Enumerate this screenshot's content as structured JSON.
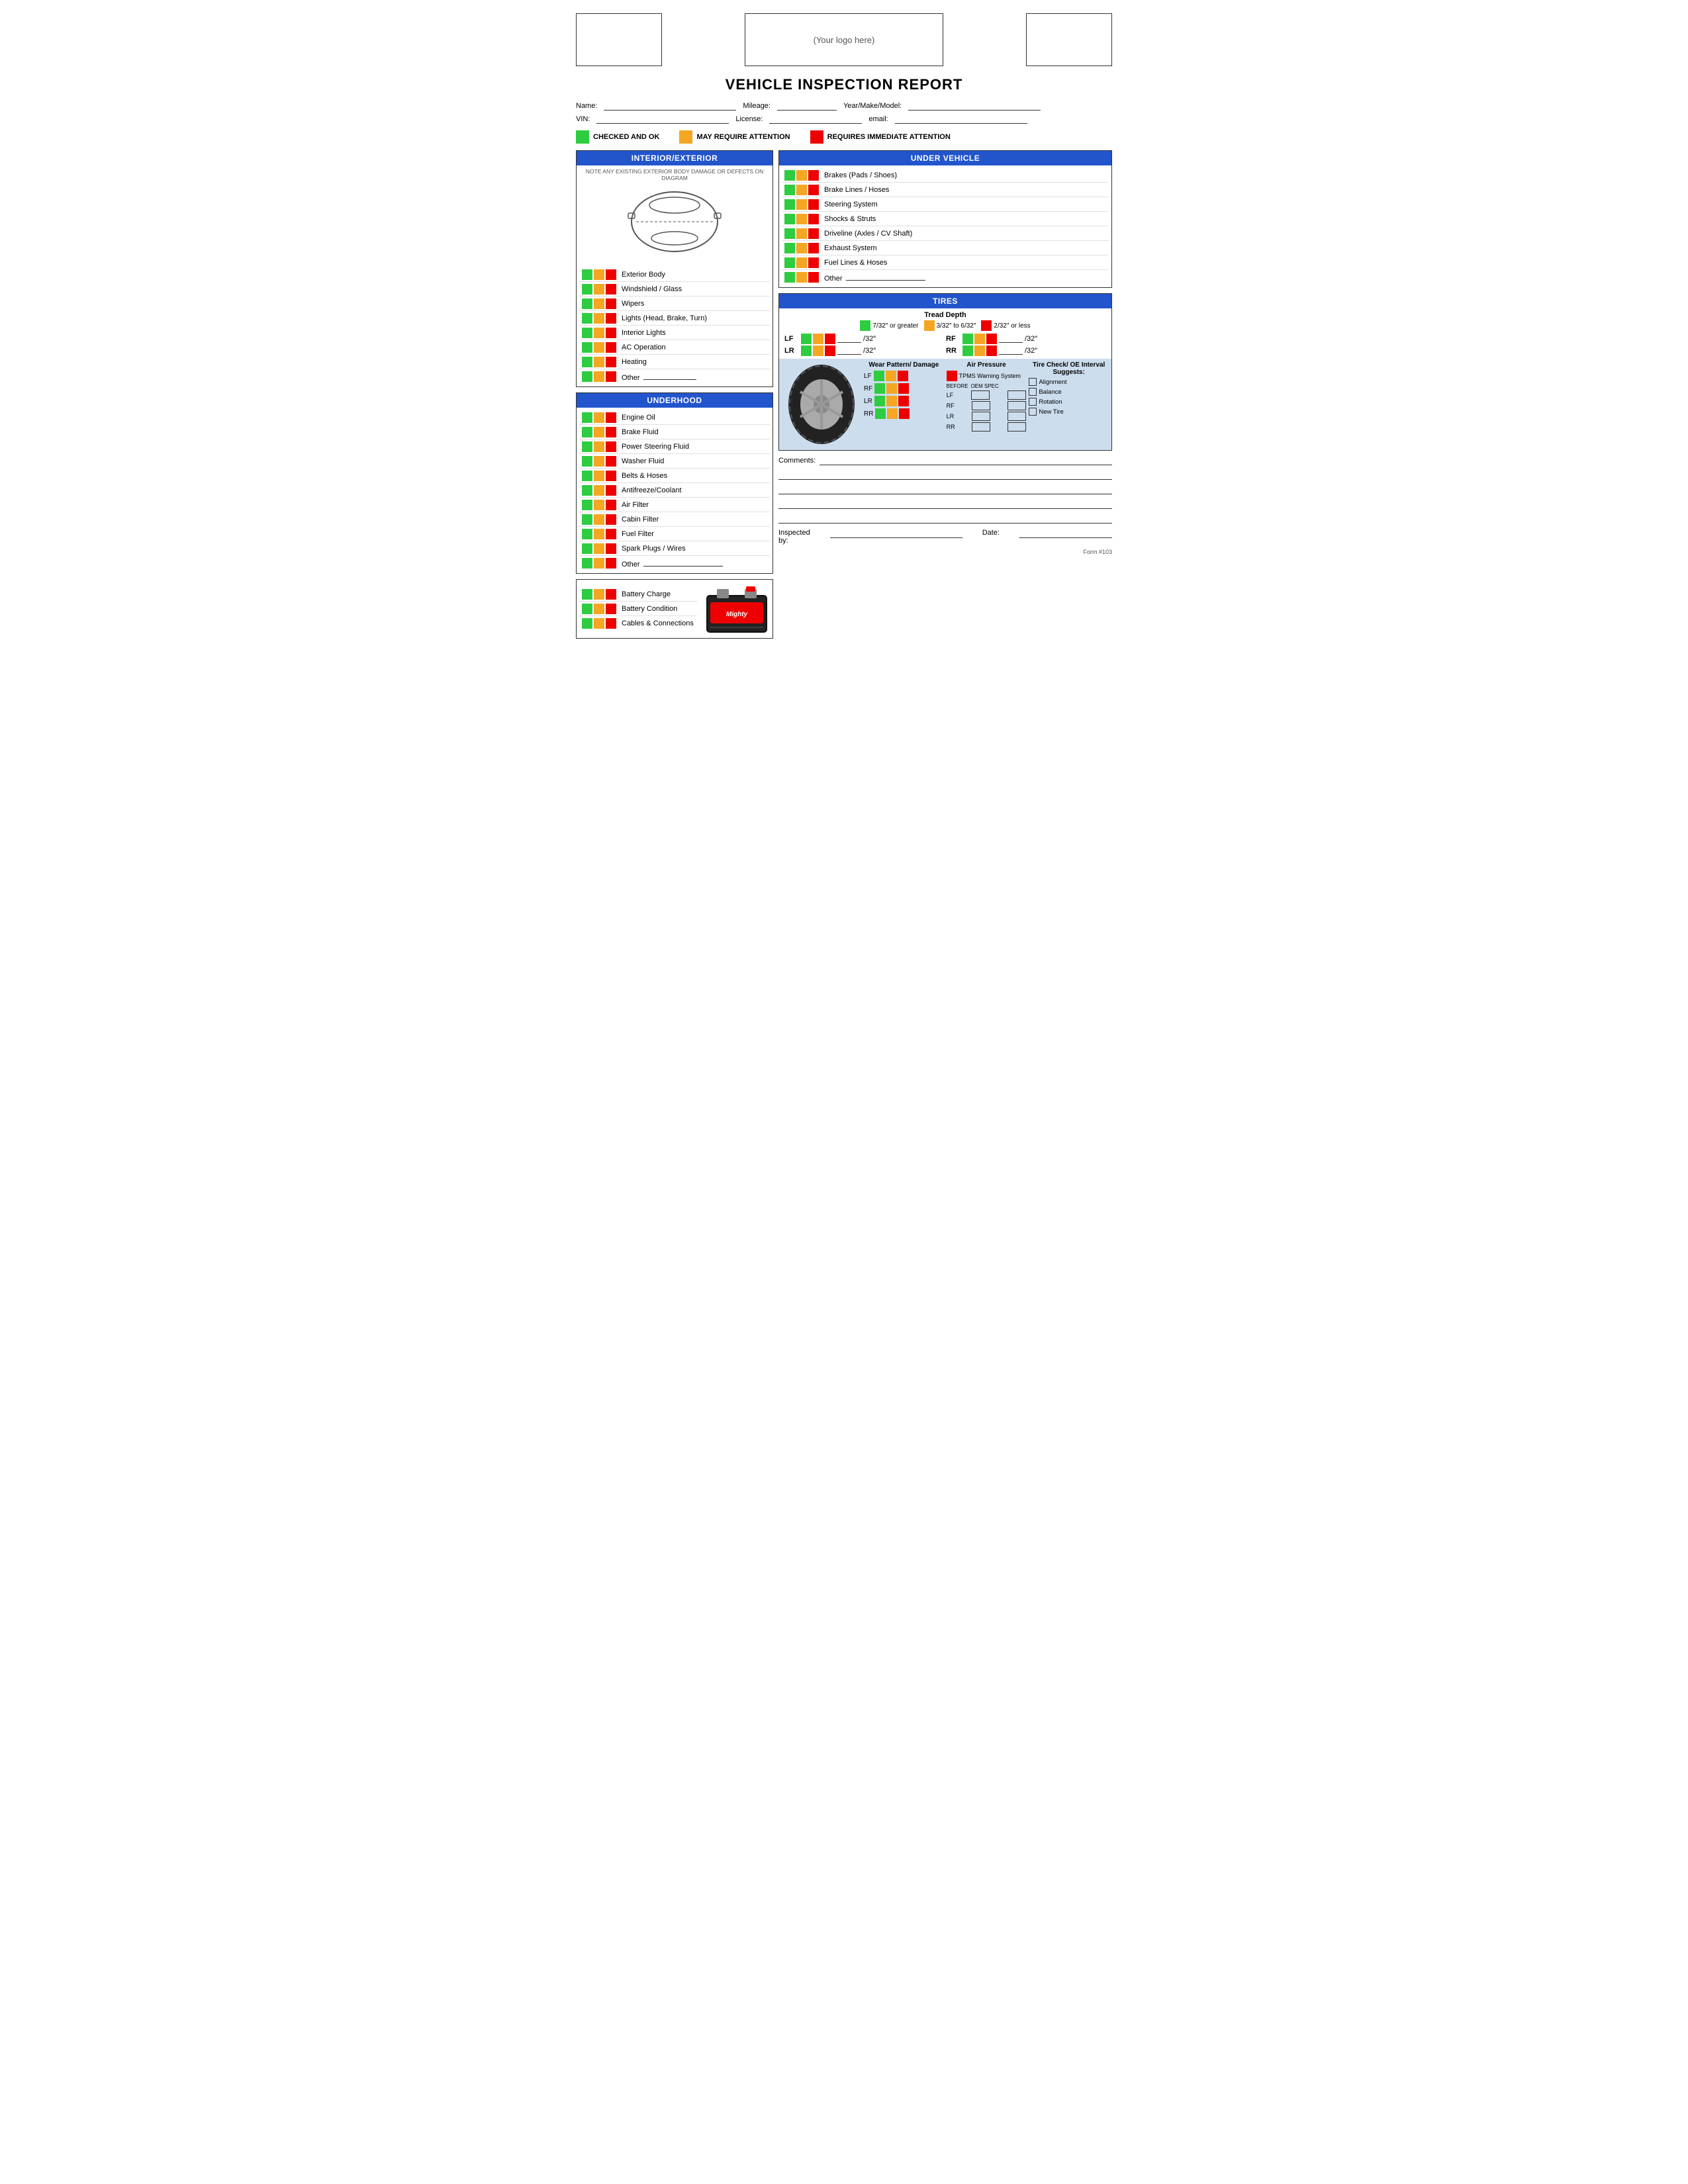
{
  "header": {
    "logo_placeholder": "(Your logo here)"
  },
  "title": "VEHICLE INSPECTION REPORT",
  "fields": {
    "name_label": "Name:",
    "mileage_label": "Mileage:",
    "year_make_model_label": "Year/Make/Model:",
    "vin_label": "VIN:",
    "license_label": "License:",
    "email_label": "email:"
  },
  "legend": {
    "green_label": "CHECKED AND OK",
    "yellow_label": "MAY REQUIRE ATTENTION",
    "red_label": "REQUIRES IMMEDIATE ATTENTION"
  },
  "interior_exterior": {
    "header": "INTERIOR/EXTERIOR",
    "note": "NOTE ANY EXISTING EXTERIOR BODY DAMAGE OR DEFECTS ON DIAGRAM",
    "items": [
      "Exterior Body",
      "Windshield / Glass",
      "Wipers",
      "Lights (Head, Brake, Turn)",
      "Interior Lights",
      "AC Operation",
      "Heating",
      "Other"
    ]
  },
  "under_vehicle": {
    "header": "UNDER VEHICLE",
    "items": [
      "Brakes (Pads / Shoes)",
      "Brake Lines / Hoses",
      "Steering System",
      "Shocks & Struts",
      "Driveline (Axles / CV Shaft)",
      "Exhaust System",
      "Fuel Lines & Hoses",
      "Other"
    ]
  },
  "underhood": {
    "header": "UNDERHOOD",
    "items": [
      "Engine Oil",
      "Brake Fluid",
      "Power Steering Fluid",
      "Washer Fluid",
      "Belts & Hoses",
      "Antifreeze/Coolant",
      "Air Filter",
      "Cabin Filter",
      "Fuel Filter",
      "Spark Plugs / Wires",
      "Other"
    ]
  },
  "battery": {
    "items": [
      "Battery Charge",
      "Battery Condition",
      "Cables & Connections"
    ]
  },
  "tires": {
    "header": "TIRES",
    "tread_depth_title": "Tread Depth",
    "tread_green_label": "7/32″ or greater",
    "tread_yellow_label": "3/32″ to 6/32″",
    "tread_red_label": "2/32″ or less",
    "positions": [
      "LF",
      "RF",
      "LR",
      "RR"
    ],
    "wear_pattern_label": "Wear Pattern/ Damage",
    "air_pressure_label": "Air Pressure",
    "tpms_label": "TPMS Warning System",
    "before_label": "BEFORE",
    "oem_spec_label": "OEM SPEC",
    "tire_check_label": "Tire Check/ OE Interval Suggests:",
    "check_options": [
      "Alignment",
      "Balance",
      "Rotation",
      "New Tire"
    ]
  },
  "comments": {
    "label": "Comments:",
    "lines": 5
  },
  "footer": {
    "inspected_by_label": "Inspected by:",
    "date_label": "Date:",
    "form_number": "Form #103"
  }
}
